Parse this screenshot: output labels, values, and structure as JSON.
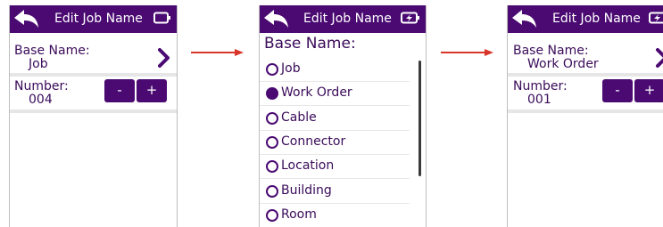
{
  "screens": [
    {
      "title": "Edit Job Name",
      "base_name_label": "Base Name:",
      "base_name_value": "Job",
      "number_label": "Number:",
      "number_value": "004",
      "minus_label": "-",
      "plus_label": "+"
    },
    {
      "title": "Edit Job Name",
      "heading": "Base Name:",
      "options": [
        {
          "label": "Job",
          "selected": false
        },
        {
          "label": "Work Order",
          "selected": true
        },
        {
          "label": "Cable",
          "selected": false
        },
        {
          "label": "Connector",
          "selected": false
        },
        {
          "label": "Location",
          "selected": false
        },
        {
          "label": "Building",
          "selected": false
        },
        {
          "label": "Room",
          "selected": false
        }
      ]
    },
    {
      "title": "Edit Job Name",
      "base_name_label": "Base Name:",
      "base_name_value": "Work Order",
      "number_label": "Number:",
      "number_value": "001",
      "minus_label": "-",
      "plus_label": "+"
    }
  ],
  "colors": {
    "header": "#4a0a72",
    "text": "#3a0b5a",
    "arrow": "#d9352b"
  },
  "icons": [
    "back-arrow-icon",
    "battery-icon",
    "battery-charging-icon",
    "chevron-right-icon",
    "radio-button-icon"
  ]
}
